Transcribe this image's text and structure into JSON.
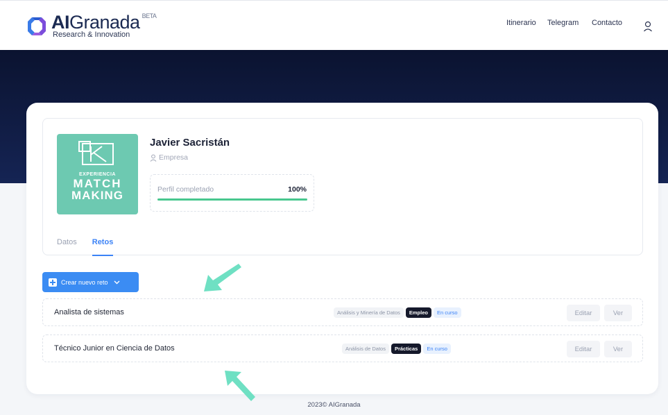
{
  "header": {
    "logo_bold": "AI",
    "logo_light": "Granada",
    "logo_beta": "BETA",
    "logo_subtitle": "Research & Innovation",
    "nav": [
      "Itinerario",
      "Telegram",
      "Contacto"
    ],
    "user_icon": "user-icon"
  },
  "profile": {
    "avatar_line1": "EXPERIENCIA",
    "avatar_line2": "MATCH",
    "avatar_line3": "MAKING",
    "name": "Javier Sacristán",
    "role": "Empresa",
    "progress_label": "Perfil completado",
    "progress_value": "100%",
    "progress_fraction": 1.0
  },
  "tabs": [
    {
      "label": "Datos",
      "active": false
    },
    {
      "label": "Retos",
      "active": true
    }
  ],
  "create_button": {
    "label": "Crear nuevo reto"
  },
  "challenges": [
    {
      "title": "Analista de sistemas",
      "tags": [
        {
          "text": "Análisis y Minería de Datos",
          "style": "grey"
        },
        {
          "text": "Empleo",
          "style": "dark"
        },
        {
          "text": "En curso",
          "style": "blue"
        }
      ],
      "edit_label": "Editar",
      "view_label": "Ver"
    },
    {
      "title": "Técnico Junior en Ciencia de Datos",
      "tags": [
        {
          "text": "Análisis de Datos",
          "style": "grey"
        },
        {
          "text": "Prácticas",
          "style": "dark"
        },
        {
          "text": "En curso",
          "style": "blue"
        }
      ],
      "edit_label": "Editar",
      "view_label": "Ver"
    }
  ],
  "footer": {
    "text": "2023© AIGranada"
  },
  "colors": {
    "accent": "#3b82f6",
    "hero": "#0b1330",
    "avatar_bg": "#6dc9b1",
    "progress": "#48c78e",
    "arrow": "#6fe0c3"
  }
}
